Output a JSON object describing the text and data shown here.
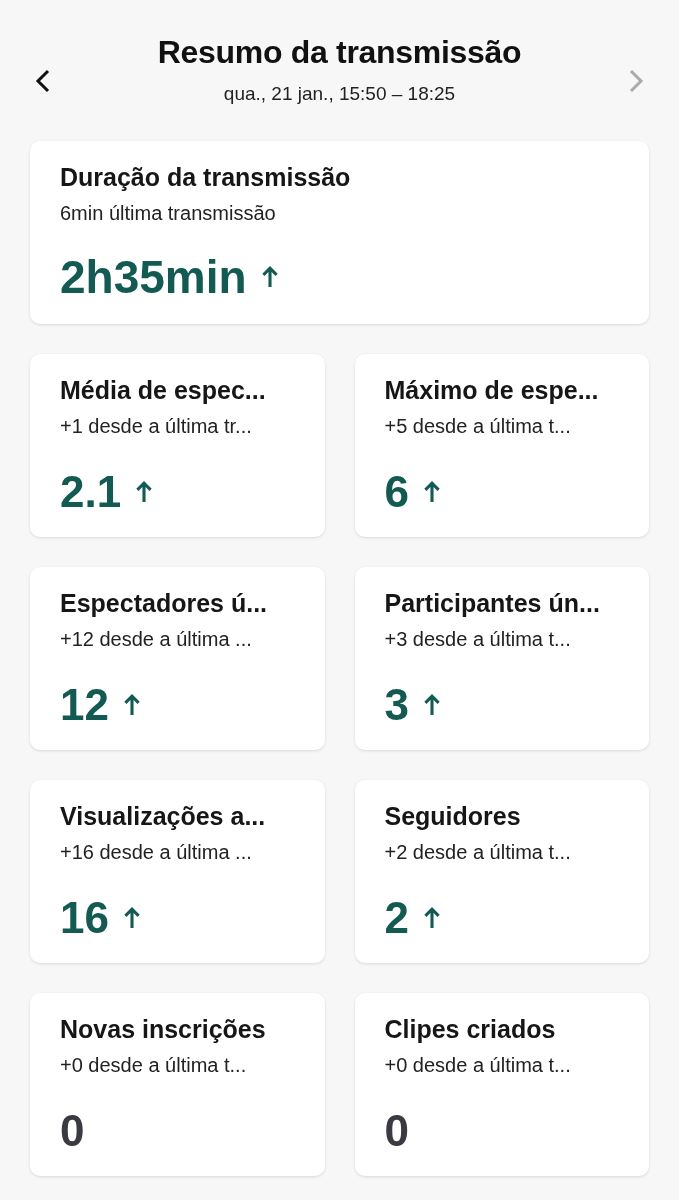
{
  "header": {
    "title": "Resumo da transmissão",
    "subtitle": "qua., 21 jan., 15:50 – 18:25",
    "prev_disabled": false,
    "next_disabled": true
  },
  "summary": {
    "title": "Duração da transmissão",
    "subtitle": "6min última transmissão",
    "value": "2h35min",
    "trending_up": true
  },
  "stats": [
    {
      "title": "Média de espec...",
      "subtitle": "+1 desde a última tr...",
      "value": "2.1",
      "trending_up": true
    },
    {
      "title": "Máximo de espe...",
      "subtitle": "+5 desde a última t...",
      "value": "6",
      "trending_up": true
    },
    {
      "title": "Espectadores ú...",
      "subtitle": "+12 desde a última ...",
      "value": "12",
      "trending_up": true
    },
    {
      "title": "Participantes ún...",
      "subtitle": "+3 desde a última t...",
      "value": "3",
      "trending_up": true
    },
    {
      "title": "Visualizações a...",
      "subtitle": "+16 desde a última ...",
      "value": "16",
      "trending_up": true
    },
    {
      "title": "Seguidores",
      "subtitle": "+2 desde a última t...",
      "value": "2",
      "trending_up": true
    },
    {
      "title": "Novas inscrições",
      "subtitle": "+0 desde a última t...",
      "value": "0",
      "trending_up": false
    },
    {
      "title": "Clipes criados",
      "subtitle": "+0 desde a última t...",
      "value": "0",
      "trending_up": false
    }
  ]
}
